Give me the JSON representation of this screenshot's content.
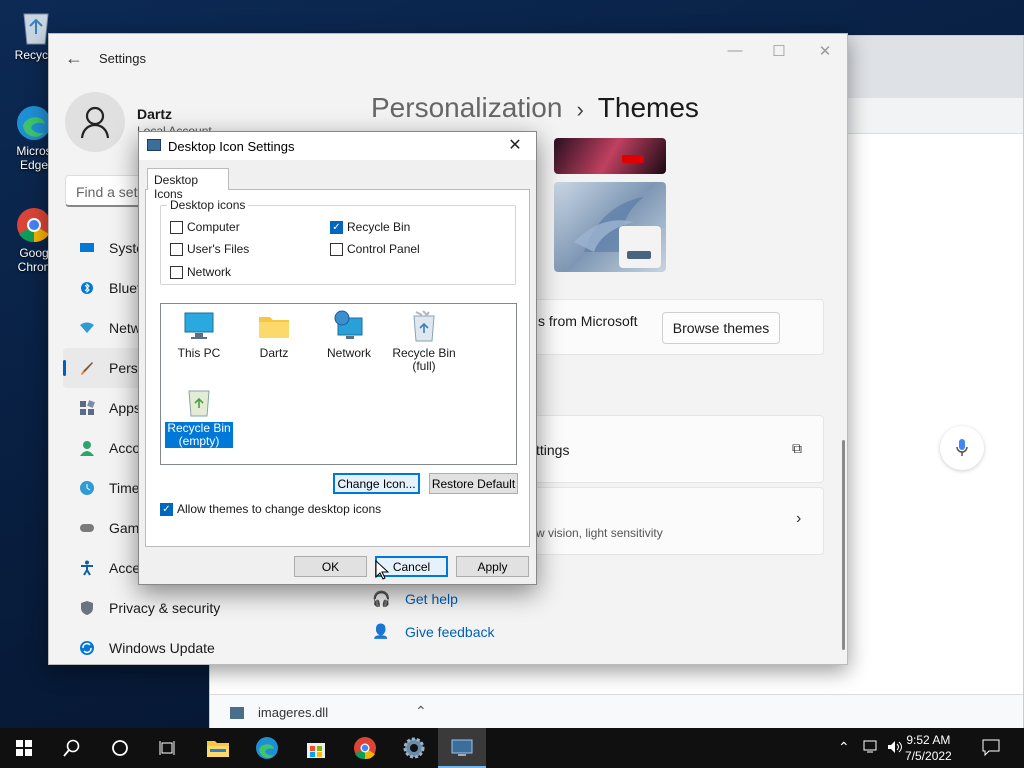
{
  "desktop": {
    "icons": [
      {
        "label": "Recycle",
        "icon": "recycle-bin-icon"
      },
      {
        "label": "Micros\nEdge",
        "icon": "edge-icon"
      },
      {
        "label": "Goog\nChron",
        "icon": "chrome-icon"
      }
    ]
  },
  "browser": {
    "download_file": "imageres.dll"
  },
  "settings": {
    "window_title": "Settings",
    "user_name": "Dartz",
    "user_type": "Local Account",
    "search_placeholder": "Find a sett",
    "nav": [
      {
        "label": "Syste",
        "icon": "system-icon",
        "color": "#0078d4"
      },
      {
        "label": "Bluet",
        "icon": "bluetooth-icon",
        "color": "#0078d4"
      },
      {
        "label": "Netw",
        "icon": "network-icon",
        "color": "#2e9bd6"
      },
      {
        "label": "Perso",
        "icon": "personalization-brush-icon",
        "color": "#e07a30",
        "selected": true
      },
      {
        "label": "Apps",
        "icon": "apps-icon",
        "color": "#5b6b85"
      },
      {
        "label": "Acco",
        "icon": "accounts-icon",
        "color": "#2aa56b"
      },
      {
        "label": "Time",
        "icon": "time-language-icon",
        "color": "#2e9bd6"
      },
      {
        "label": "Gam",
        "icon": "gaming-icon",
        "color": "#7a7a7a"
      },
      {
        "label": "Acce",
        "icon": "accessibility-icon",
        "color": "#0c5fa8"
      },
      {
        "label": "Privacy & security",
        "icon": "shield-icon",
        "color": "#6b7280"
      },
      {
        "label": "Windows Update",
        "icon": "windows-update-icon",
        "color": "#0078d4"
      }
    ],
    "breadcrumb_parent": "Personalization",
    "breadcrumb_sep": "›",
    "breadcrumb_current": "Themes",
    "store_text": "s from Microsoft",
    "browse_themes": "Browse themes",
    "related_text": "ttings",
    "contrast_text": "w vision, light sensitivity",
    "get_help": "Get help",
    "give_feedback": "Give feedback"
  },
  "dialog": {
    "title": "Desktop Icon Settings",
    "tab": "Desktop Icons",
    "group_label": "Desktop icons",
    "checkboxes": [
      {
        "label": "Computer",
        "checked": false
      },
      {
        "label": "Recycle Bin",
        "checked": true
      },
      {
        "label": "User's Files",
        "checked": false
      },
      {
        "label": "Control Panel",
        "checked": false
      },
      {
        "label": "Network",
        "checked": false
      }
    ],
    "icons": [
      {
        "label": "This PC",
        "icon": "monitor-icon"
      },
      {
        "label": "Dartz",
        "icon": "folder-icon"
      },
      {
        "label": "Network",
        "icon": "network-globe-icon"
      },
      {
        "label": "Recycle Bin\n(full)",
        "icon": "recycle-bin-full-icon"
      },
      {
        "label": "Recycle Bin\n(empty)",
        "icon": "recycle-bin-empty-icon",
        "selected": true
      }
    ],
    "change_icon": "Change Icon...",
    "restore_default": "Restore Default",
    "allow_themes": "Allow themes to change desktop icons",
    "allow_themes_checked": true,
    "ok": "OK",
    "cancel": "Cancel",
    "apply": "Apply"
  },
  "taskbar": {
    "time": "9:52 AM",
    "date": "7/5/2022"
  },
  "colors": {
    "accent": "#0067c0",
    "selection": "#0078d7"
  }
}
